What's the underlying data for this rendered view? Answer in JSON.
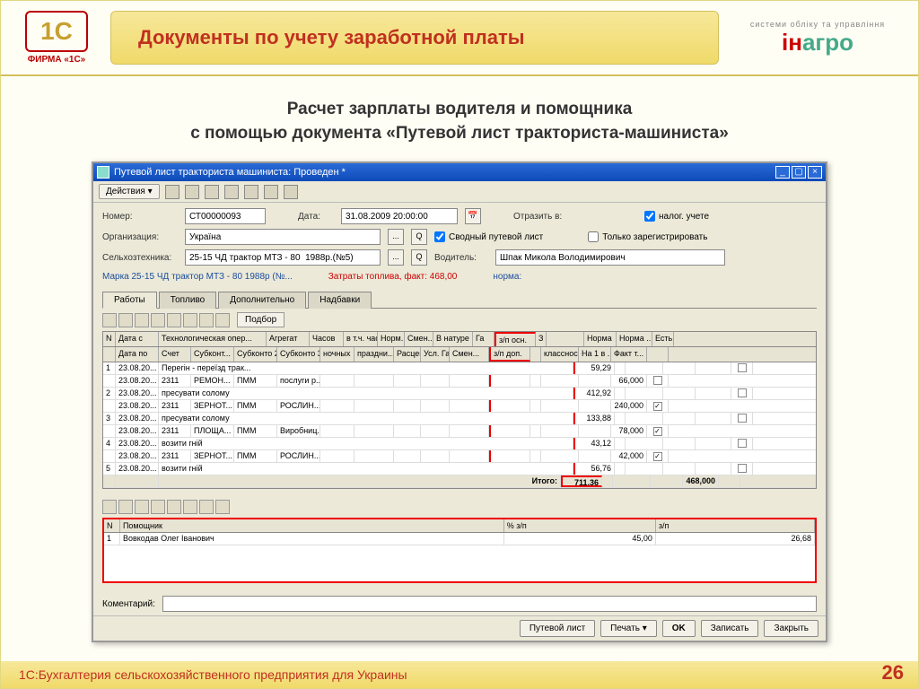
{
  "slide": {
    "logo_label": "ФИРМА «1С»",
    "title": "Документы по учету заработной платы",
    "inagro_tag": "системи обліку та управління",
    "subtitle1": "Расчет зарплаты водителя и помощника",
    "subtitle2": "с помощью документа «Путевой лист тракториста-машиниста»",
    "footer": "1С:Бухгалтерия сельскохозяйственного предприятия для Украины",
    "page": "26"
  },
  "window": {
    "title": "Путевой лист тракториста машиниста: Проведен *",
    "actions_label": "Действия",
    "form": {
      "number_label": "Номер:",
      "number": "СТ00000093",
      "date_label": "Дата:",
      "date": "31.08.2009 20:00:00",
      "reflect_label": "Отразить в:",
      "tax_check": "налог. учете",
      "org_label": "Организация:",
      "org": "Україна",
      "consolidated": "Сводный путевой лист",
      "only_register": "Только зарегистрировать",
      "tech_label": "Сельхозтехника:",
      "tech": "25-15 ЧД трактор МТЗ - 80  1988р.(№5)",
      "driver_label": "Водитель:",
      "driver": "Шпак Микола Володимирович",
      "info_brand": "Марка 25-15 ЧД трактор МТЗ - 80  1988р (№...",
      "info_fuel": "Затраты топлива, факт:  468,00",
      "info_norm": "норма:"
    },
    "tabs": [
      "Работы",
      "Топливо",
      "Дополнительно",
      "Надбавки"
    ],
    "podbor": "Подбор",
    "grid": {
      "hdr1": [
        "N",
        "Дата с",
        "Технологическая опер...",
        "Агрегат",
        "Часов",
        "в т.ч. час...",
        "Норм...",
        "Смен...",
        "В натуре",
        "Га",
        "з/п осн.",
        "З",
        "",
        "Норма",
        "Норма ...",
        "Есть"
      ],
      "hdr2": [
        "",
        "Дата по",
        "Счет",
        "Субконт...",
        "Субконто 2",
        "Субконто 3",
        "ночных",
        "праздни...",
        "Расценка",
        "Усл. Га",
        "Смен...",
        "з/п доп.",
        "",
        "классность",
        "На 1 в ...",
        "Факт т...",
        ""
      ],
      "rows": [
        {
          "n": "1",
          "date": "23.08.20...",
          "tech": "Перегін - переїзд трак...",
          "zp": "59,29",
          "ft": "",
          "chk": false
        },
        {
          "n": "",
          "date": "23.08.20...",
          "acc": "2311",
          "sub1": "РЕМОН...",
          "sub2": "ПММ",
          "sub3": "послуги р...",
          "zp": "",
          "ft": "66,000",
          "chk": false
        },
        {
          "n": "2",
          "date": "23.08.20...",
          "tech": "пресувати солому",
          "zp": "412,92",
          "ft": "",
          "chk": false
        },
        {
          "n": "",
          "date": "23.08.20...",
          "acc": "2311",
          "sub1": "ЗЕРНОТ...",
          "sub2": "ПММ",
          "sub3": "РОСЛИН...",
          "zp": "",
          "ft": "240,000",
          "chk": true
        },
        {
          "n": "3",
          "date": "23.08.20...",
          "tech": "пресувати солому",
          "zp": "133,88",
          "ft": "",
          "chk": false
        },
        {
          "n": "",
          "date": "23.08.20...",
          "acc": "2311",
          "sub1": "ПЛОЩА...",
          "sub2": "ПММ",
          "sub3": "Виробниц...",
          "zp": "",
          "ft": "78,000",
          "chk": true
        },
        {
          "n": "4",
          "date": "23.08.20...",
          "tech": "возити гній",
          "zp": "43,12",
          "ft": "",
          "chk": false
        },
        {
          "n": "",
          "date": "23.08.20...",
          "acc": "2311",
          "sub1": "ЗЕРНОТ...",
          "sub2": "ПММ",
          "sub3": "РОСЛИН...",
          "zp": "",
          "ft": "42,000",
          "chk": true
        },
        {
          "n": "5",
          "date": "23.08.20...",
          "tech": "возити гній",
          "zp": "56,76",
          "ft": "",
          "chk": false
        }
      ],
      "total_label": "Итого:",
      "total_zp": "711,36",
      "total_ft": "468,000"
    },
    "helpers": {
      "hdr": [
        "N",
        "Помощник",
        "% з/п",
        "з/п"
      ],
      "row": {
        "n": "1",
        "name": "Вовкодав Олег Іванович",
        "pct": "45,00",
        "zp": "26,68"
      }
    },
    "comment_label": "Коментарий:",
    "footer_btns": [
      "Путевой лист",
      "Печать",
      "OK",
      "Записать",
      "Закрыть"
    ]
  }
}
